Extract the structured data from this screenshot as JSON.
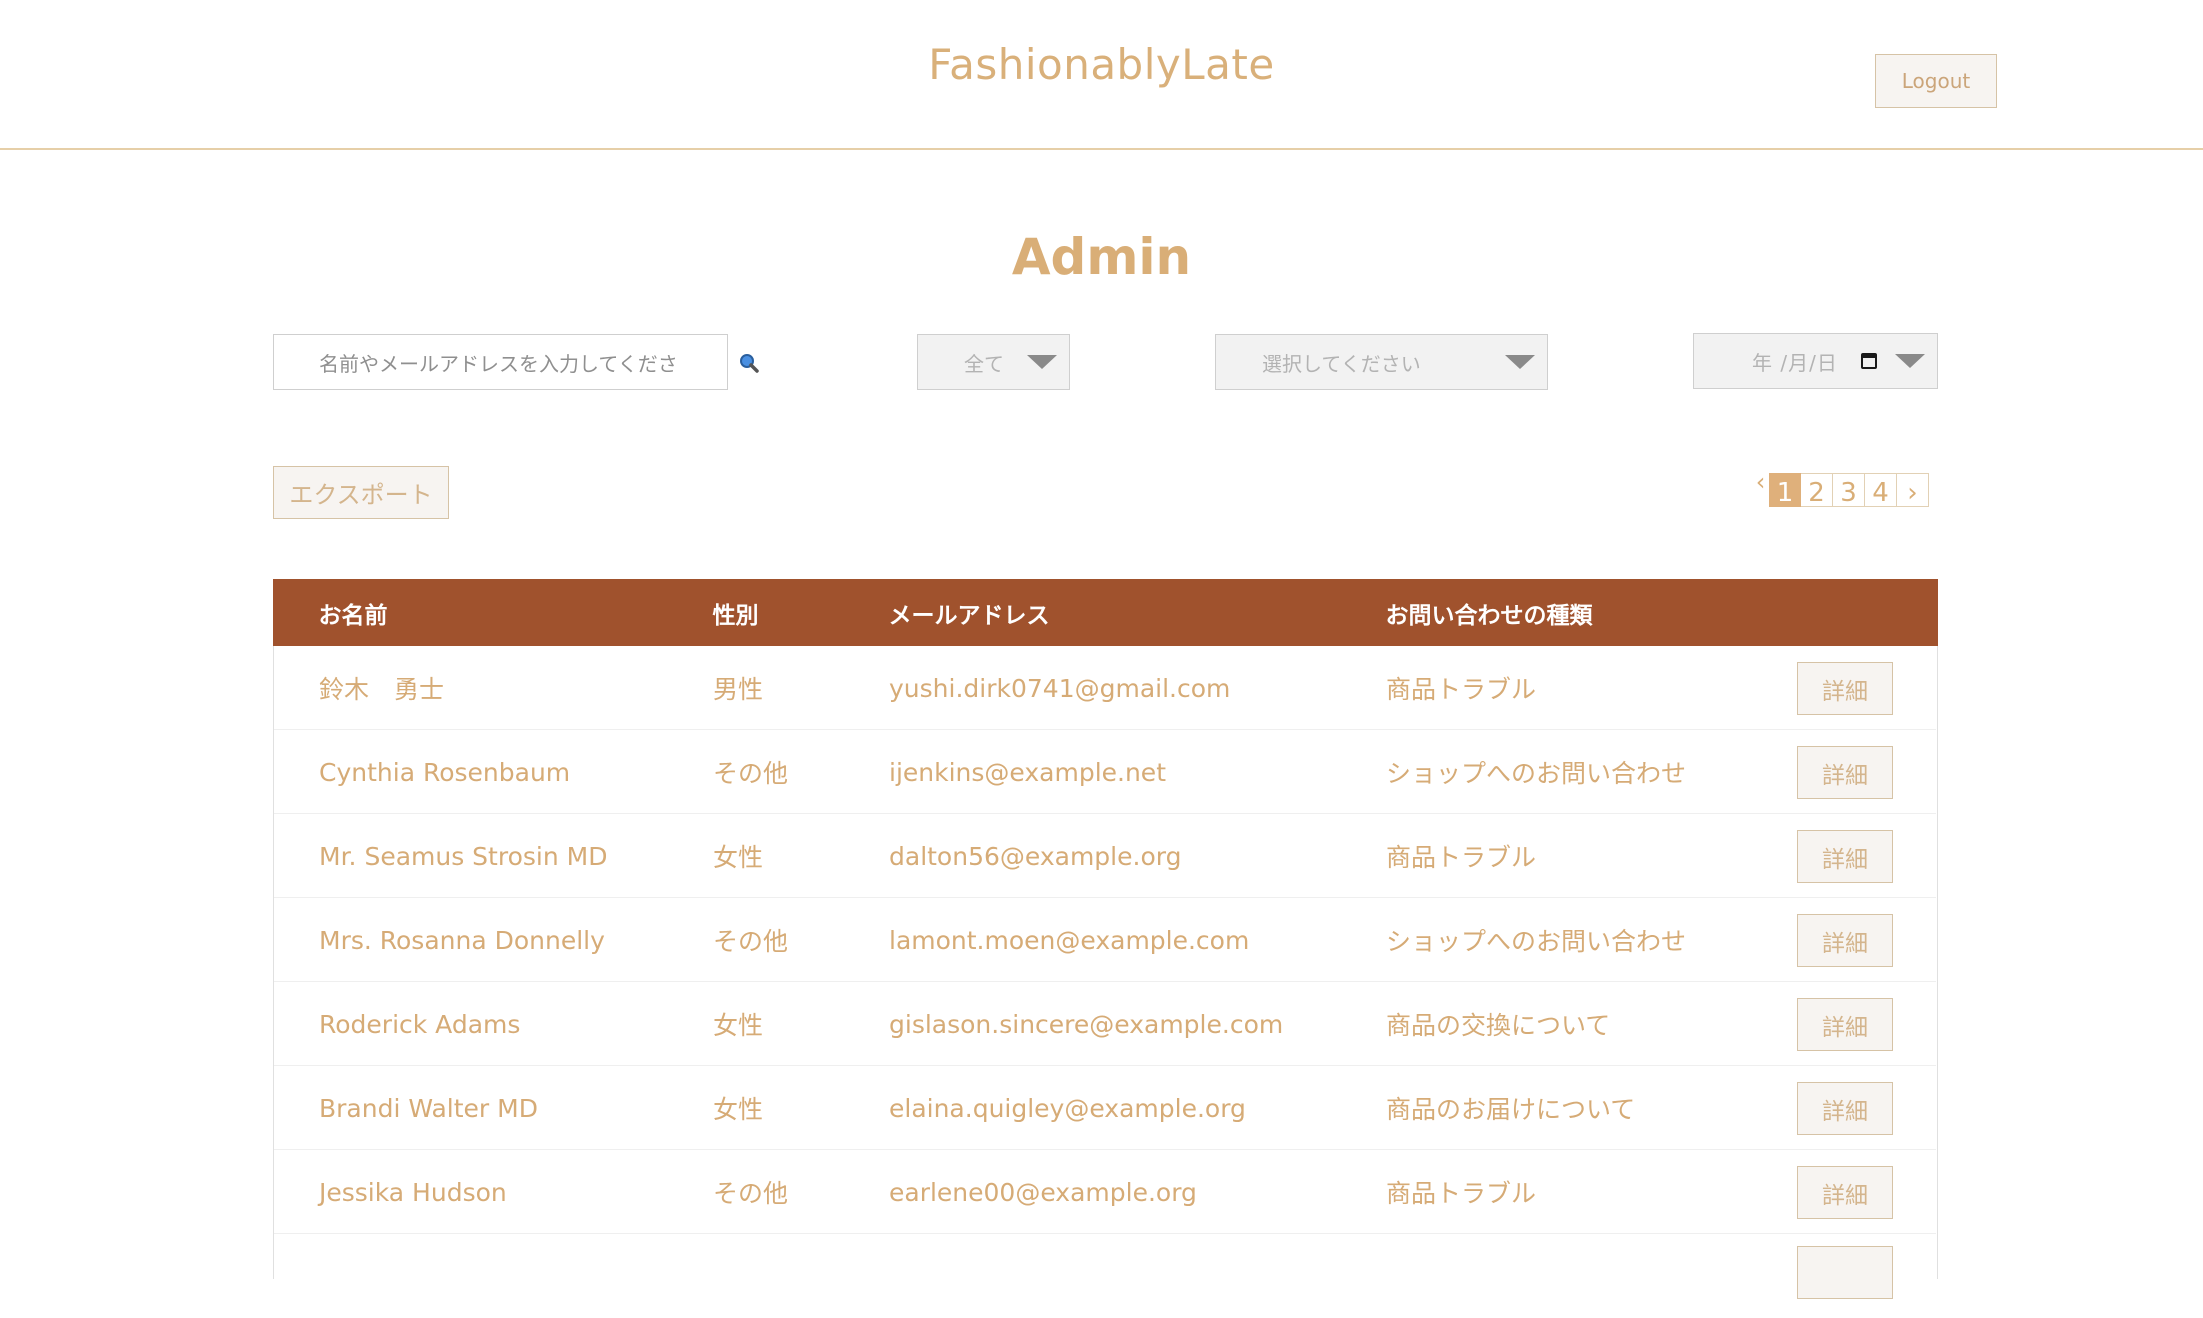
{
  "header": {
    "brand": "FashionablyLate",
    "logout_label": "Logout"
  },
  "page_title": "Admin",
  "filters": {
    "search_placeholder": "名前やメールアドレスを入力してくださ",
    "gender_selected": "全て",
    "type_selected": "選択してください",
    "date_placeholder": "年 /月/日"
  },
  "export_label": "エクスポート",
  "pagination": {
    "prev": "‹",
    "pages": [
      "1",
      "2",
      "3",
      "4"
    ],
    "next": "›",
    "current": "1"
  },
  "table": {
    "headers": [
      "お名前",
      "性別",
      "メールアドレス",
      "お問い合わせの種類"
    ],
    "detail_label": "詳細",
    "rows": [
      {
        "name": "鈴木　勇士",
        "gender": "男性",
        "email": "yushi.dirk0741@gmail.com",
        "type": "商品トラブル"
      },
      {
        "name": "Cynthia Rosenbaum",
        "gender": "その他",
        "email": "ijenkins@example.net",
        "type": "ショップへのお問い合わせ"
      },
      {
        "name": "Mr. Seamus Strosin MD",
        "gender": "女性",
        "email": "dalton56@example.org",
        "type": "商品トラブル"
      },
      {
        "name": "Mrs. Rosanna Donnelly",
        "gender": "その他",
        "email": "lamont.moen@example.com",
        "type": "ショップへのお問い合わせ"
      },
      {
        "name": "Roderick Adams",
        "gender": "女性",
        "email": "gislason.sincere@example.com",
        "type": "商品の交換について"
      },
      {
        "name": "Brandi Walter MD",
        "gender": "女性",
        "email": "elaina.quigley@example.org",
        "type": "商品のお届けについて"
      },
      {
        "name": "Jessika Hudson",
        "gender": "その他",
        "email": "earlene00@example.org",
        "type": "商品トラブル"
      }
    ]
  },
  "colors": {
    "accent": "#d9ae77",
    "table_header": "#a0522d",
    "border": "#e6cfa8"
  }
}
